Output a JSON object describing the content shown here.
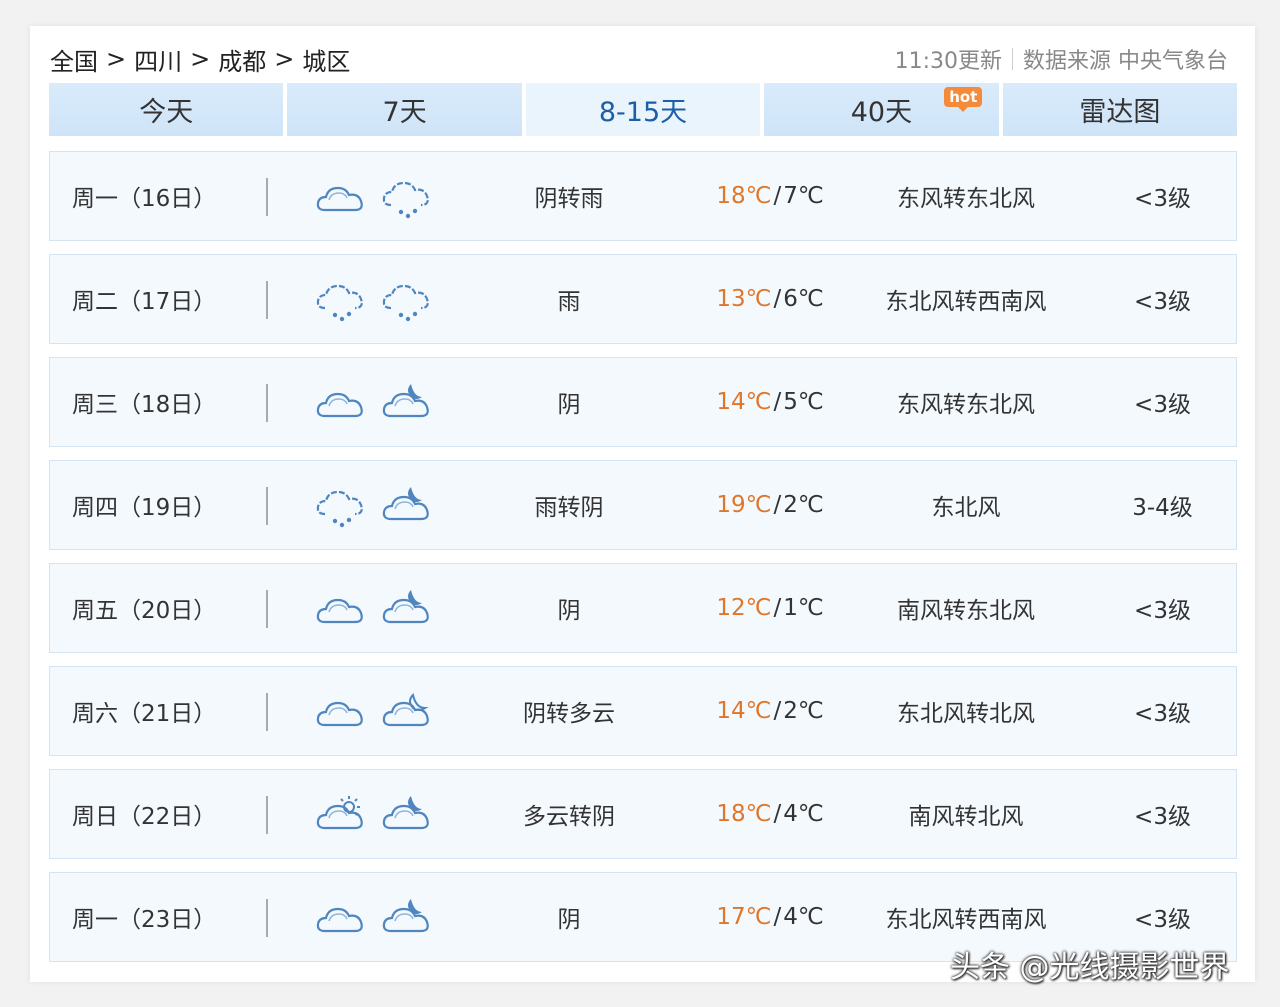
{
  "breadcrumb": {
    "items": [
      "全国",
      "四川",
      "成都",
      "城区"
    ],
    "separator": ">"
  },
  "meta": {
    "update_time": "11:30更新",
    "source": "数据来源 中央气象台"
  },
  "tabs": [
    {
      "label": "今天"
    },
    {
      "label": "7天"
    },
    {
      "label": "8-15天",
      "active": true
    },
    {
      "label": "40天",
      "badge": "hot"
    },
    {
      "label": "雷达图"
    }
  ],
  "colors": {
    "accent": "#1a5fa8",
    "high_temp": "#e0762a",
    "icon_stroke": "#4f86c0",
    "tab_bg": "#d3e7fa",
    "row_bg": "#f4f9fe"
  },
  "forecast": [
    {
      "date": "周一（16日）",
      "icon_day": "cloudy-icon",
      "icon_night": "rain-icon",
      "desc": "阴转雨",
      "high": "18℃",
      "low": "7℃",
      "wind": "东风转东北风",
      "level": "<3级"
    },
    {
      "date": "周二（17日）",
      "icon_day": "rain-icon",
      "icon_night": "rain-icon",
      "desc": "雨",
      "high": "13℃",
      "low": "6℃",
      "wind": "东北风转西南风",
      "level": "<3级"
    },
    {
      "date": "周三（18日）",
      "icon_day": "cloudy-icon",
      "icon_night": "cloudy-night-icon",
      "desc": "阴",
      "high": "14℃",
      "low": "5℃",
      "wind": "东风转东北风",
      "level": "<3级"
    },
    {
      "date": "周四（19日）",
      "icon_day": "rain-icon",
      "icon_night": "cloudy-night-icon",
      "desc": "雨转阴",
      "high": "19℃",
      "low": "2℃",
      "wind": "东北风",
      "level": "3-4级"
    },
    {
      "date": "周五（20日）",
      "icon_day": "cloudy-icon",
      "icon_night": "cloudy-night-icon",
      "desc": "阴",
      "high": "12℃",
      "low": "1℃",
      "wind": "南风转东北风",
      "level": "<3级"
    },
    {
      "date": "周六（21日）",
      "icon_day": "cloudy-icon",
      "icon_night": "partly-cloudy-night-icon",
      "desc": "阴转多云",
      "high": "14℃",
      "low": "2℃",
      "wind": "东北风转北风",
      "level": "<3级"
    },
    {
      "date": "周日（22日）",
      "icon_day": "partly-cloudy-day-icon",
      "icon_night": "cloudy-night-icon",
      "desc": "多云转阴",
      "high": "18℃",
      "low": "4℃",
      "wind": "南风转北风",
      "level": "<3级"
    },
    {
      "date": "周一（23日）",
      "icon_day": "cloudy-icon",
      "icon_night": "cloudy-night-icon",
      "desc": "阴",
      "high": "17℃",
      "low": "4℃",
      "wind": "东北风转西南风",
      "level": "<3级"
    }
  ],
  "watermark": "头条 @光线摄影世界"
}
